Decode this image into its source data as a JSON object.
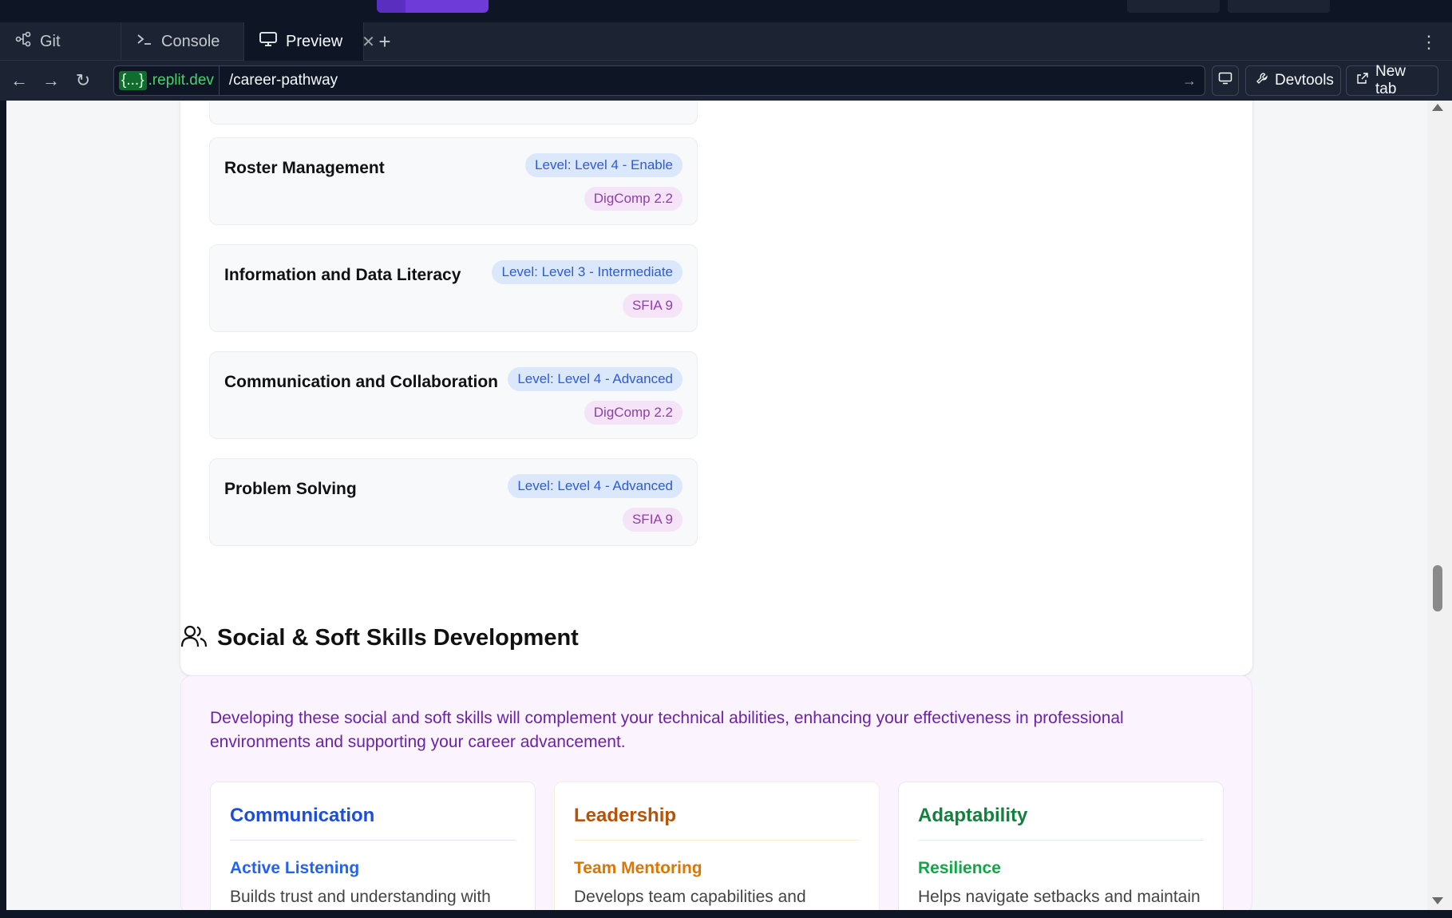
{
  "tabs": [
    {
      "label": "Git",
      "icon": "git-branch-icon"
    },
    {
      "label": "Console",
      "icon": "terminal-icon"
    },
    {
      "label": "Preview",
      "icon": "monitor-icon",
      "active": true
    }
  ],
  "url": {
    "domain_bracket": "{...}",
    "domain": ".replit.dev",
    "path": "/career-pathway"
  },
  "toolbar": {
    "devtools_label": "Devtools",
    "newtab_label": "New tab"
  },
  "skills": [
    {
      "name": "Roster Management",
      "level": "Level: Level 4 - Enable",
      "framework": "DigComp 2.2"
    },
    {
      "name": "Information and Data Literacy",
      "level": "Level: Level 3 - Intermediate",
      "framework": "SFIA 9"
    },
    {
      "name": "Communication and Collaboration",
      "level": "Level: Level 4 - Advanced",
      "framework": "DigComp 2.2"
    },
    {
      "name": "Problem Solving",
      "level": "Level: Level 4 - Advanced",
      "framework": "SFIA 9"
    }
  ],
  "soft_skills": {
    "title": "Social & Soft Skills Development",
    "intro": "Developing these social and soft skills will complement your technical abilities, enhancing your effectiveness in professional environments and supporting your career advancement.",
    "columns": [
      {
        "heading": "Communication",
        "skill": "Active Listening",
        "description": "Builds trust and understanding with",
        "color": "#1d4ed8",
        "skill_color": "#2563eb",
        "rule": "#dbe5f7"
      },
      {
        "heading": "Leadership",
        "skill": "Team Mentoring",
        "description": "Develops team capabilities and",
        "color": "#b45309",
        "skill_color": "#d97706",
        "rule": "#fbeed0"
      },
      {
        "heading": "Adaptability",
        "skill": "Resilience",
        "description": "Helps navigate setbacks and maintain",
        "color": "#15803d",
        "skill_color": "#16a34a",
        "rule": "#dcefe3"
      }
    ]
  }
}
